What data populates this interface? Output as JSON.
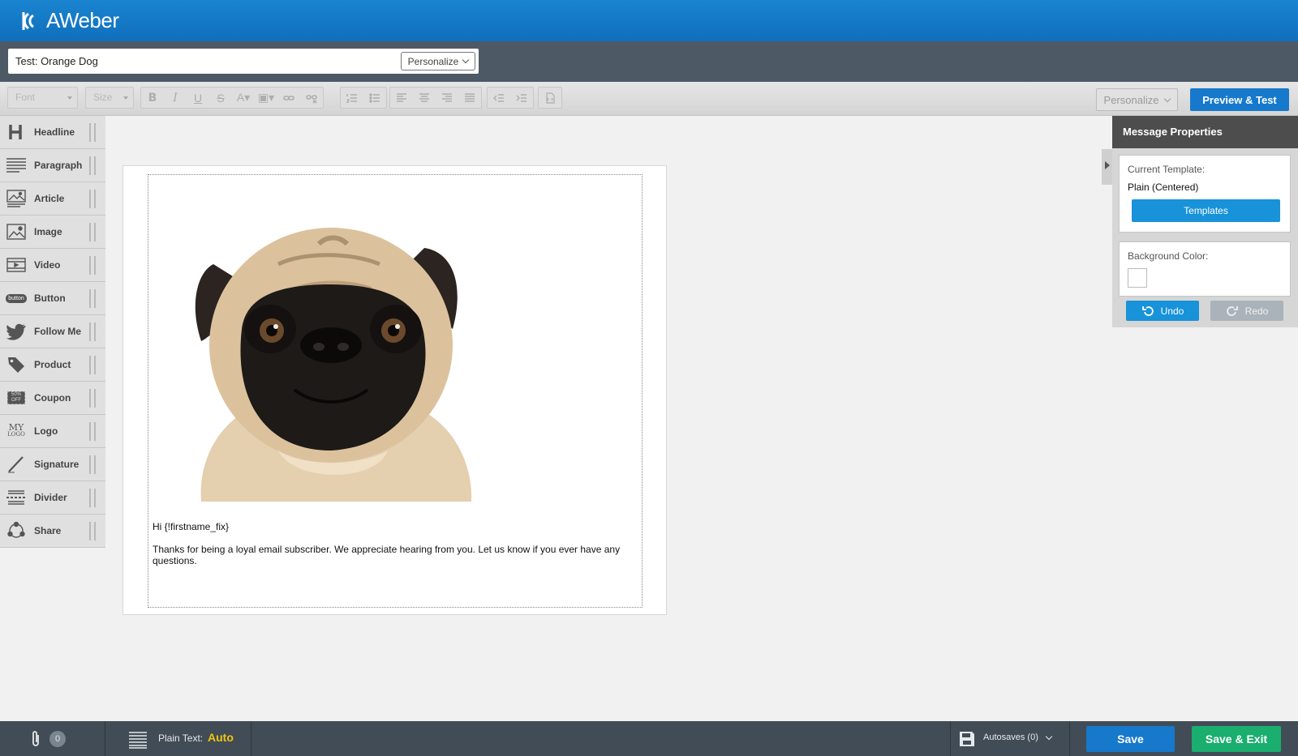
{
  "brand": {
    "name": "AWeber"
  },
  "subject": {
    "value": "Test: Orange Dog",
    "personalize_label": "Personalize"
  },
  "toolbar": {
    "font_placeholder": "Font",
    "size_placeholder": "Size",
    "personalize_label": "Personalize",
    "preview_label": "Preview & Test"
  },
  "sidebar": {
    "items": [
      {
        "label": "Headline",
        "icon": "headline-icon"
      },
      {
        "label": "Paragraph",
        "icon": "paragraph-icon"
      },
      {
        "label": "Article",
        "icon": "article-icon"
      },
      {
        "label": "Image",
        "icon": "image-icon"
      },
      {
        "label": "Video",
        "icon": "video-icon"
      },
      {
        "label": "Button",
        "icon": "button-icon",
        "icon_text": "button"
      },
      {
        "label": "Follow Me",
        "icon": "twitter-icon"
      },
      {
        "label": "Product",
        "icon": "tag-icon"
      },
      {
        "label": "Coupon",
        "icon": "coupon-icon",
        "icon_text": "50% OFF"
      },
      {
        "label": "Logo",
        "icon": "logo-icon",
        "icon_text_1": "MY",
        "icon_text_2": "LOGO"
      },
      {
        "label": "Signature",
        "icon": "pen-icon"
      },
      {
        "label": "Divider",
        "icon": "divider-icon"
      },
      {
        "label": "Share",
        "icon": "share-icon"
      }
    ]
  },
  "message": {
    "greeting": "Hi {!firstname_fix}",
    "body": "Thanks for being a loyal email subscriber. We appreciate hearing from you. Let us know if you ever have any questions."
  },
  "properties": {
    "title": "Message Properties",
    "template_label": "Current Template:",
    "template_value": "Plain (Centered)",
    "templates_button": "Templates",
    "background_label": "Background Color:",
    "background_color": "#ffffff",
    "undo_label": "Undo",
    "redo_label": "Redo"
  },
  "footer": {
    "attachments_count": "0",
    "plain_text_label": "Plain Text:",
    "plain_text_value": "Auto",
    "autosaves_label": "Autosaves (0)",
    "save_label": "Save",
    "save_exit_label": "Save & Exit"
  },
  "colors": {
    "brand_blue": "#1679cc",
    "accent_blue": "#1892d9",
    "success_green": "#1aae6f",
    "dark_bar": "#414c56",
    "auto_yellow": "#f1c40f"
  }
}
